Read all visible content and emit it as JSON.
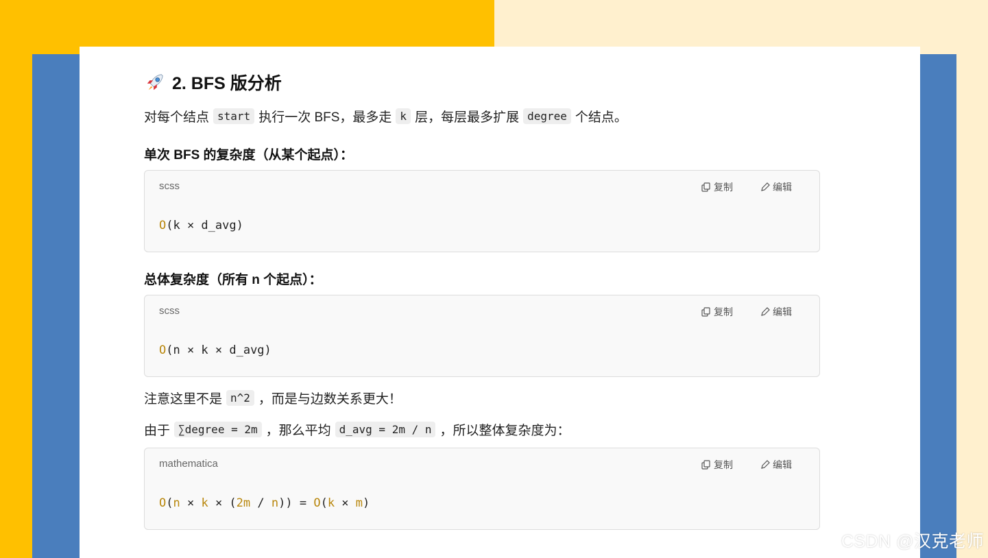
{
  "heading": {
    "emoji": "rocket",
    "text": "2. BFS 版分析"
  },
  "intro": {
    "t1": "对每个结点",
    "c1": "start",
    "t2": "执行一次 BFS，最多走",
    "c2": "k",
    "t3": "层，每层最多扩展",
    "c3": "degree",
    "t4": "个结点。"
  },
  "sub1": "单次 BFS 的复杂度（从某个起点）：",
  "block1": {
    "lang": "scss",
    "copy": "复制",
    "edit": "编辑",
    "code_prefix": "O",
    "code_rest": "(k × d_avg)"
  },
  "sub2": "总体复杂度（所有 n 个起点）：",
  "block2": {
    "lang": "scss",
    "copy": "复制",
    "edit": "编辑",
    "code_prefix": "O",
    "code_rest": "(n × k × d_avg)"
  },
  "note": {
    "t1": "注意这里不是",
    "c1": "n^2",
    "t2": "，而是与边数关系更大！"
  },
  "since": {
    "t1": "由于",
    "c1": "∑degree = 2m",
    "t2": "，那么平均",
    "c2": "d_avg = 2m / n",
    "t3": "，所以整体复杂度为："
  },
  "block3": {
    "lang": "mathematica",
    "copy": "复制",
    "edit": "编辑",
    "tokens": [
      "O",
      "(",
      "n",
      " × ",
      "k",
      " × (",
      "2m",
      " / ",
      "n",
      ")) = ",
      "O",
      "(",
      "k",
      " × ",
      "m",
      ")"
    ]
  },
  "watermark": "CSDN @汉克老师",
  "colors": {
    "yellow": "#ffc000",
    "blue": "#4a7ebd",
    "cream": "#fff0ce",
    "keyword": "#b8860b"
  }
}
